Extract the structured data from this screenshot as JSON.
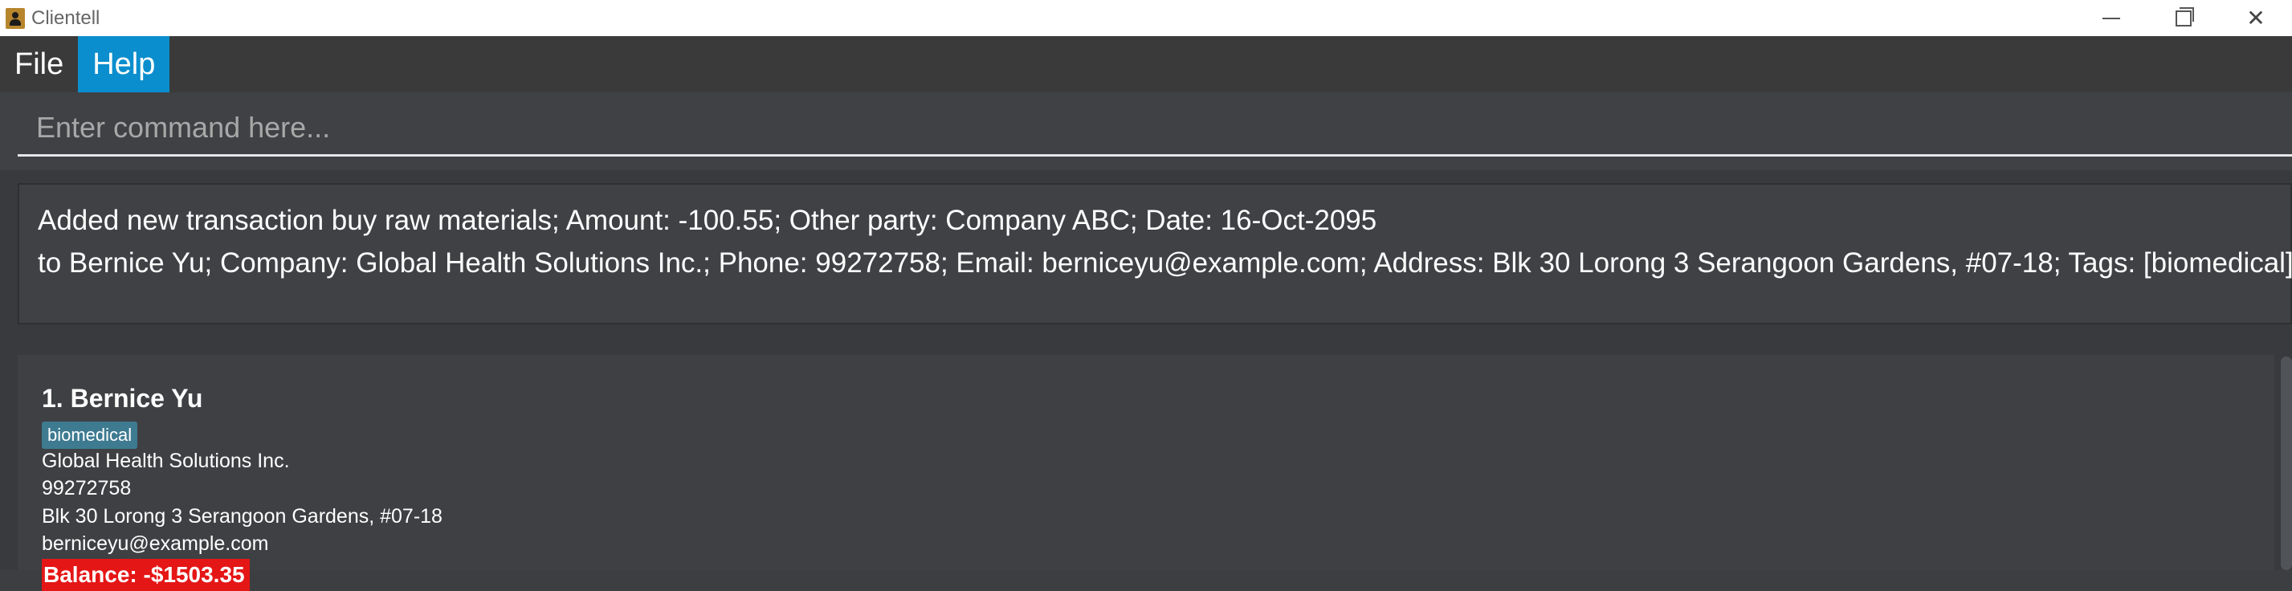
{
  "window": {
    "title": "Clientell",
    "icon": "app-contact-icon",
    "minimize_icon": "minimize-icon",
    "restore_icon": "restore-icon",
    "close_symbol": "✕"
  },
  "menu": {
    "items": [
      {
        "label": "File"
      },
      {
        "label": "Help"
      }
    ]
  },
  "command": {
    "placeholder": "Enter command here...",
    "value": ""
  },
  "result": {
    "lines": [
      "Added new transaction buy raw materials; Amount: -100.55; Other party: Company ABC; Date: 16-Oct-2095",
      "to Bernice Yu; Company: Global Health Solutions Inc.; Phone: 99272758; Email: berniceyu@example.com; Address: Blk 30 Lorong 3 Serangoon Gardens, #07-18; Tags: [biomedical]"
    ]
  },
  "persons": [
    {
      "name": "1. Bernice Yu",
      "tags": [
        "biomedical"
      ],
      "company": "Global Health Solutions Inc.",
      "phone": "99272758",
      "address": "Blk 30 Lorong 3 Serangoon Gardens, #07-18",
      "email": "berniceyu@example.com",
      "balance": "Balance: -$1503.35"
    }
  ],
  "colors": {
    "accent": "#0b8ecd",
    "background": "#3c3e41",
    "tag": "#3e7b91",
    "negative_balance": "#e51616"
  }
}
